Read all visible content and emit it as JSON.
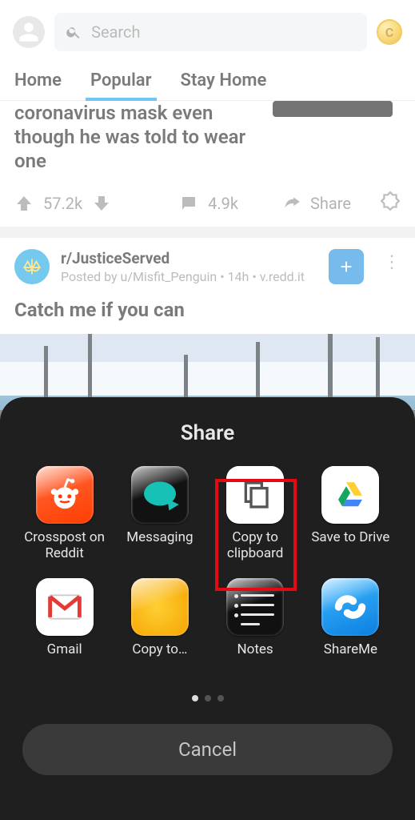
{
  "search": {
    "placeholder": "Search"
  },
  "coin": {
    "letter": "C"
  },
  "tabs": [
    {
      "label": "Home",
      "active": false
    },
    {
      "label": "Popular",
      "active": true
    },
    {
      "label": "Stay Home",
      "active": false
    }
  ],
  "post1": {
    "title_tail": "coronavirus mask even though he was told to wear one",
    "upvotes": "57.2k",
    "comments": "4.9k",
    "share": "Share"
  },
  "post2": {
    "subreddit": "r/JusticeServed",
    "byline": "Posted by u/Misfit_Penguin • 14h • v.redd.it",
    "title": "Catch me if you can"
  },
  "sheet": {
    "title": "Share",
    "cancel": "Cancel",
    "items": [
      {
        "label": "Crosspost on Reddit"
      },
      {
        "label": "Messaging"
      },
      {
        "label": "Copy to clipboard"
      },
      {
        "label": "Save to Drive"
      },
      {
        "label": "Gmail"
      },
      {
        "label": "Copy to…"
      },
      {
        "label": "Notes"
      },
      {
        "label": "ShareMe"
      }
    ],
    "page_index": 0,
    "page_count": 3
  }
}
